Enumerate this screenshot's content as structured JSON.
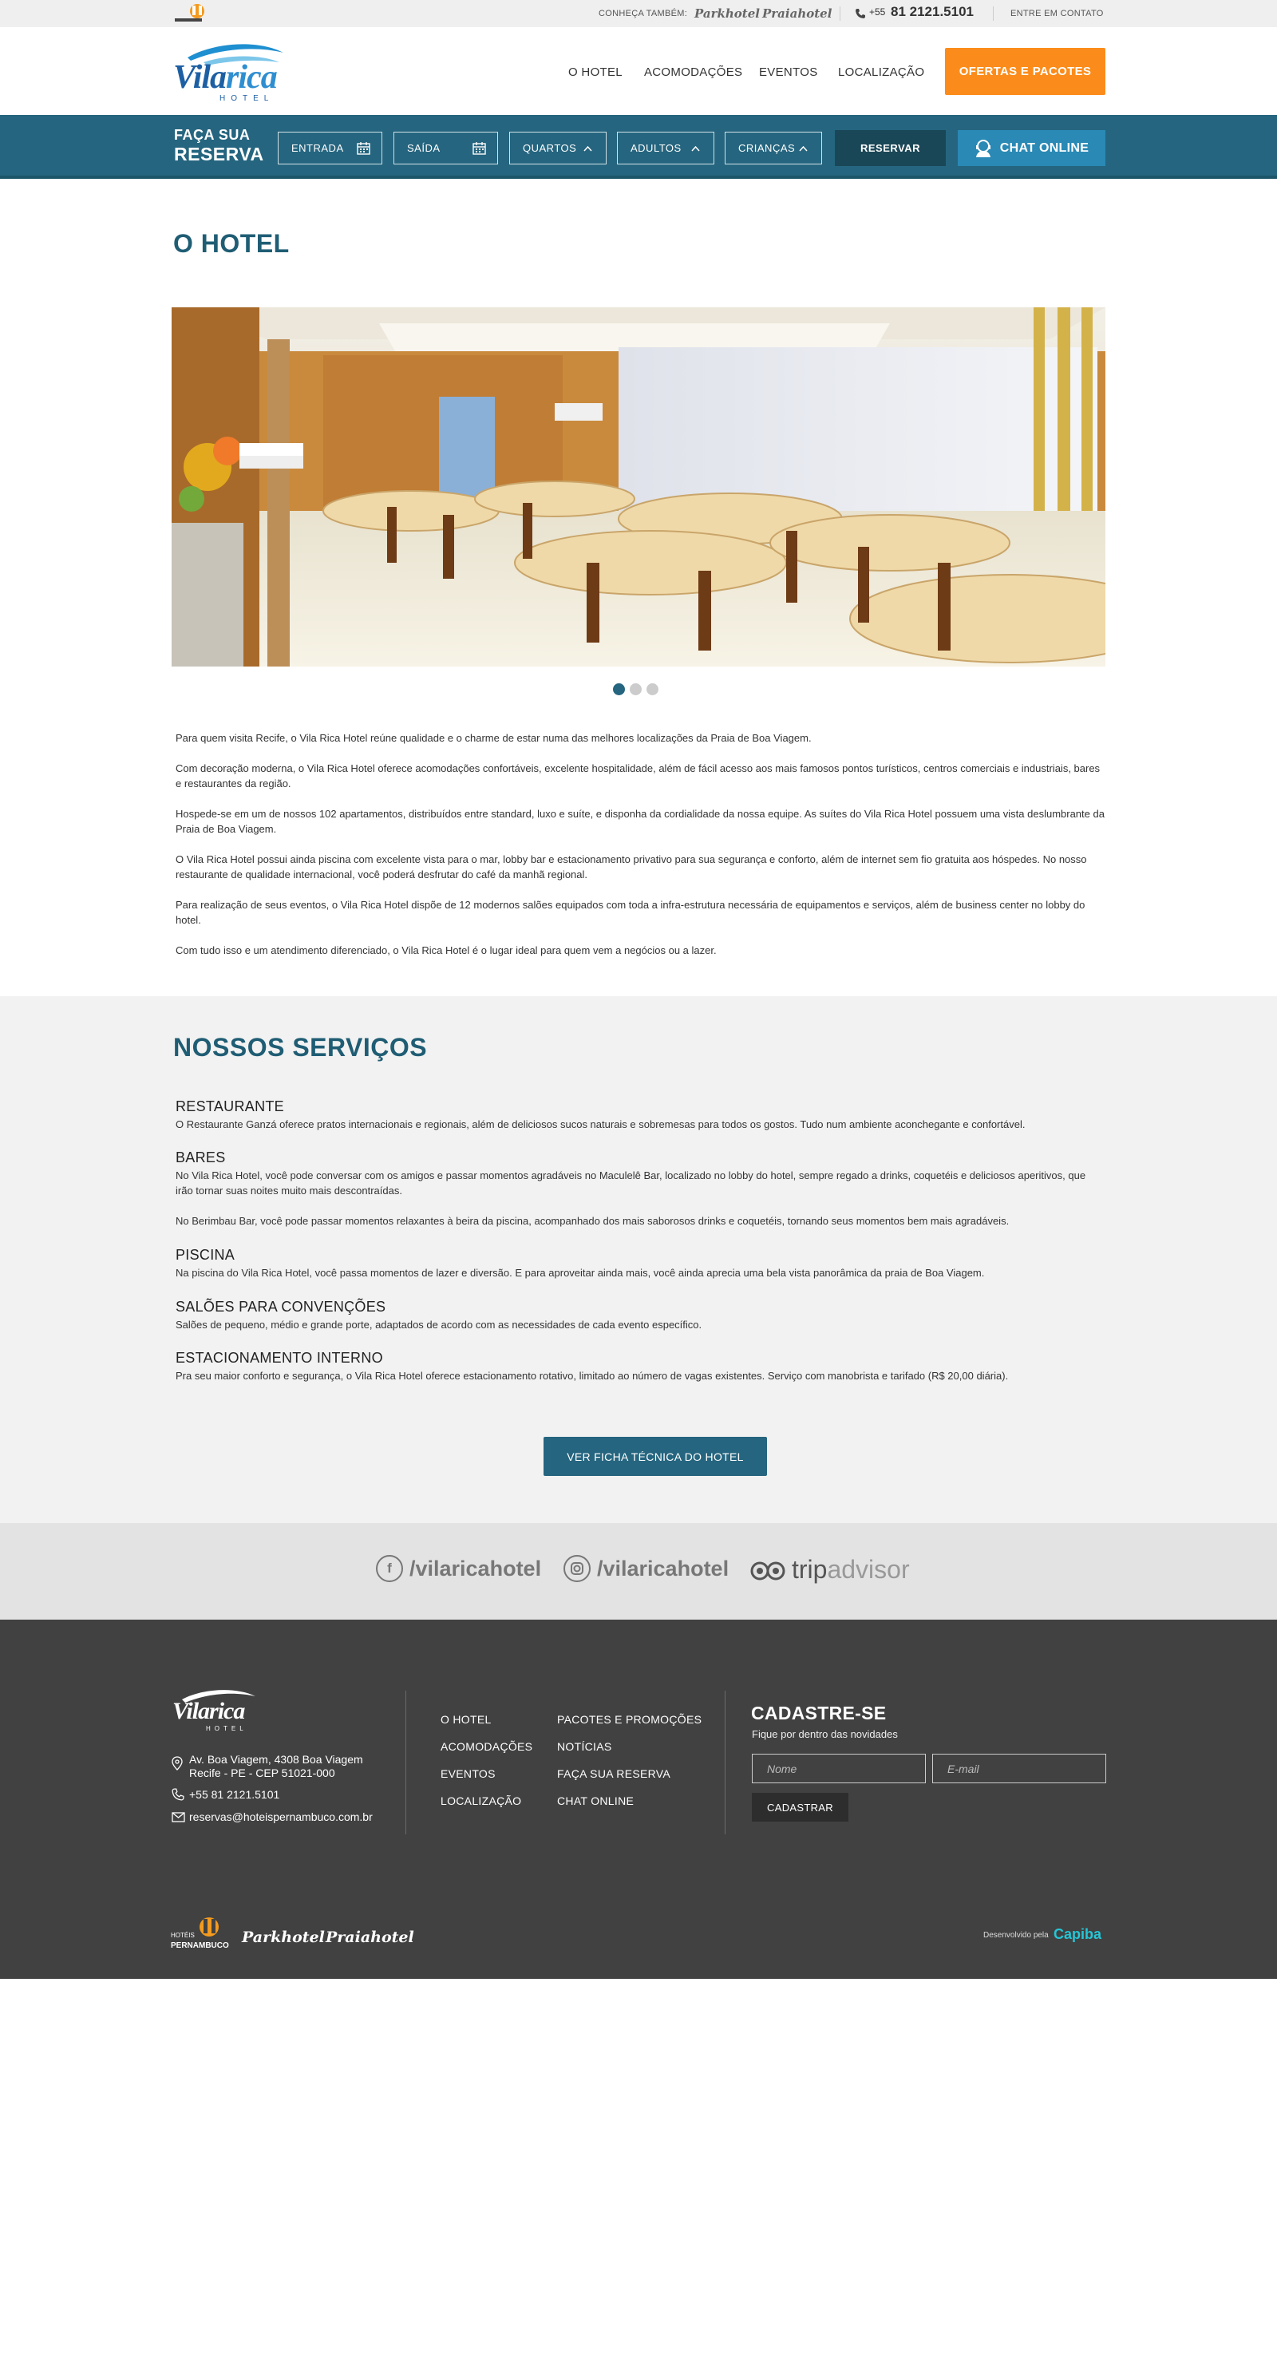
{
  "topbar": {
    "conheca": "CONHEÇA TAMBÉM:",
    "brand1": "Parkhotel",
    "brand2": "Praiahotel",
    "phone_prefix": "+55",
    "phone": "81 2121.5101",
    "contact": "ENTRE EM CONTATO"
  },
  "logo": {
    "name_a": "Vila",
    "name_b": "rica",
    "sub": "HOTEL"
  },
  "nav": [
    "O HOTEL",
    "ACOMODAÇÕES",
    "EVENTOS",
    "LOCALIZAÇÃO"
  ],
  "offers_button": "OFERTAS E PACOTES",
  "reservation": {
    "title_l1": "FAÇA SUA",
    "title_l2": "RESERVA",
    "checkin": "ENTRADA",
    "checkout": "SAÍDA",
    "rooms": "QUARTOS",
    "adults": "ADULTOS",
    "children": "CRIANÇAS",
    "submit": "RESERVAR",
    "chat": "CHAT ONLINE"
  },
  "hotel": {
    "title": "O HOTEL",
    "slider_active": 1,
    "slider_count": 3,
    "paragraphs": [
      "Para quem visita Recife, o Vila Rica Hotel reúne qualidade e o charme de estar numa das melhores localizações da Praia de Boa Viagem.",
      "Com decoração moderna, o Vila Rica Hotel oferece acomodações confortáveis, excelente hospitalidade, além de fácil acesso aos mais famosos pontos turísticos, centros comerciais e industriais, bares e restaurantes da região.",
      "Hospede-se em um de nossos 102 apartamentos, distribuídos entre standard, luxo e suíte, e disponha da cordialidade da nossa equipe. As suítes do Vila Rica Hotel possuem uma vista deslumbrante da Praia de Boa Viagem.",
      "O Vila Rica Hotel possui ainda piscina com excelente vista para o mar, lobby bar e estacionamento privativo para sua segurança e conforto, além de internet sem fio gratuita aos hóspedes. No nosso restaurante de qualidade internacional, você poderá desfrutar do café da manhã regional.",
      "Para realização de seus eventos, o Vila Rica Hotel dispõe de 12 modernos salões equipados com toda a infra-estrutura necessária de equipamentos e serviços, além de business center no lobby do hotel.",
      "Com tudo isso e um atendimento diferenciado, o Vila Rica Hotel é o lugar ideal para quem vem a negócios ou a lazer."
    ]
  },
  "services": {
    "title": "NOSSOS SERVIÇOS",
    "items": [
      {
        "name": "RESTAURANTE",
        "text": "O Restaurante Ganzá oferece pratos internacionais e regionais, além de deliciosos sucos naturais e sobremesas para todos os gostos. Tudo num ambiente aconchegante e confortável."
      },
      {
        "name": "BARES",
        "text": "No Vila Rica Hotel, você pode conversar com os amigos e passar momentos agradáveis no Maculelê Bar, localizado no lobby do hotel, sempre regado a drinks, coquetéis e deliciosos aperitivos, que irão tornar suas noites muito mais descontraídas.",
        "text2": "No Berimbau Bar, você pode passar momentos relaxantes à beira da piscina, acompanhado dos mais saborosos drinks e coquetéis, tornando seus momentos bem mais agradáveis."
      },
      {
        "name": "PISCINA",
        "text": "Na piscina do Vila Rica Hotel, você passa momentos de lazer e diversão. E para aproveitar ainda mais, você ainda aprecia uma bela vista panorâmica da praia de Boa Viagem."
      },
      {
        "name": "SALÕES PARA CONVENÇÕES",
        "text": "Salões de pequeno, médio e grande porte, adaptados de acordo com as necessidades de cada evento específico."
      },
      {
        "name": "ESTACIONAMENTO INTERNO",
        "text": "Pra seu maior conforto e segurança, o Vila Rica Hotel oferece estacionamento rotativo, limitado ao número de vagas existentes. Serviço com manobrista e tarifado (R$ 20,00 diária)."
      }
    ],
    "button": "VER FICHA TÉCNICA DO HOTEL"
  },
  "social": {
    "facebook": "/vilaricahotel",
    "instagram": "/vilaricahotel",
    "trip_a": "trip",
    "trip_b": "advisor"
  },
  "footer": {
    "address_l1": "Av. Boa Viagem, 4308 Boa Viagem",
    "address_l2": "Recife - PE - CEP 51021-000",
    "phone": "+55 81 2121.5101",
    "email": "reservas@hoteispernambuco.com.br",
    "links_col1": [
      "O HOTEL",
      "ACOMODAÇÕES",
      "EVENTOS",
      "LOCALIZAÇÃO"
    ],
    "links_col2": [
      "PACOTES E PROMOÇÕES",
      "NOTÍCIAS",
      "FAÇA SUA RESERVA",
      "CHAT ONLINE"
    ],
    "newsletter_title": "CADASTRE-SE",
    "newsletter_sub": "Fique por dentro das novidades",
    "name_placeholder": "Nome",
    "email_placeholder": "E-mail",
    "submit": "CADASTRAR",
    "hp_hoteis": "HOTÉIS",
    "hp_pernambuco": "PERNAMBUCO",
    "dev_label": "Desenvolvido pela",
    "dev_name": "Capiba"
  }
}
